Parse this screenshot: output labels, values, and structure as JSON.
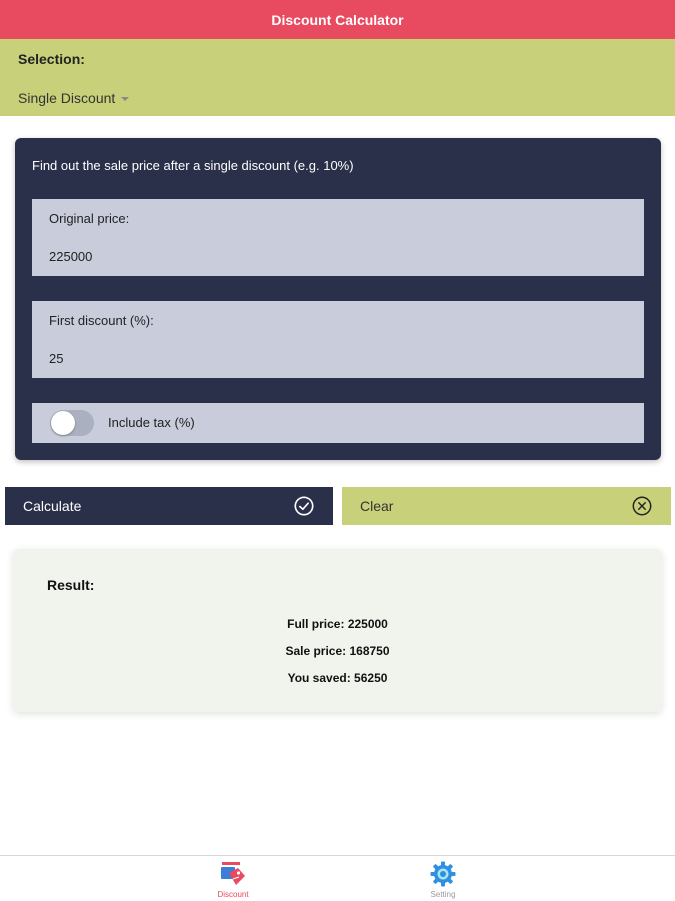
{
  "header": {
    "title": "Discount Calculator"
  },
  "selection": {
    "label": "Selection:",
    "value": "Single Discount"
  },
  "card": {
    "description": "Find out the sale price after a single discount (e.g. 10%)",
    "original_price": {
      "label": "Original price:",
      "value": "225000"
    },
    "first_discount": {
      "label": "First discount (%):",
      "value": "25"
    },
    "tax": {
      "label": "Include tax (%)",
      "enabled": false
    }
  },
  "buttons": {
    "calculate": "Calculate",
    "clear": "Clear"
  },
  "result": {
    "title": "Result:",
    "full_price": "Full price: 225000",
    "sale_price": "Sale price: 168750",
    "you_saved": "You saved: 56250"
  },
  "tabs": [
    {
      "label": "Discount",
      "icon": "discount-tag-icon",
      "active": true
    },
    {
      "label": "Setting",
      "icon": "gear-icon",
      "active": false
    }
  ],
  "colors": {
    "header": "#e84a5f",
    "accent": "#c8d17a",
    "card": "#2a3049"
  }
}
